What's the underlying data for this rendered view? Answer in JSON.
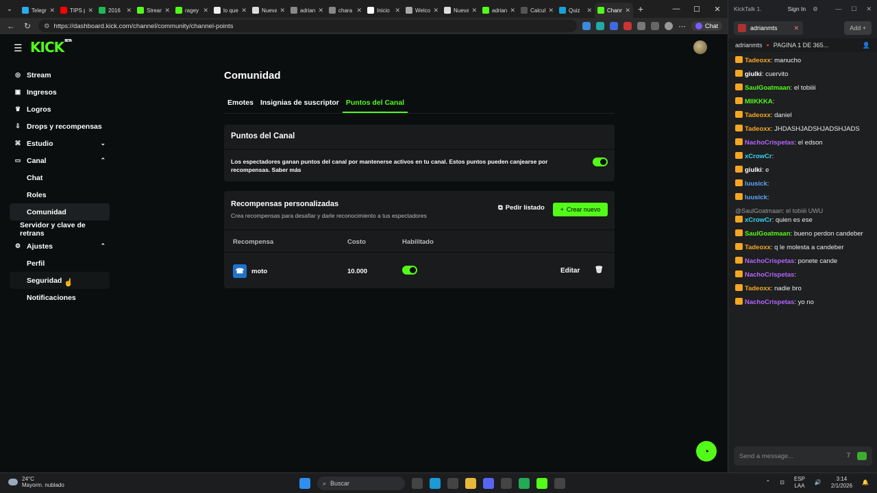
{
  "browser": {
    "tabs": [
      {
        "title": "Telegr",
        "color": "#2aabee"
      },
      {
        "title": "TIPS p",
        "color": "#ff0000"
      },
      {
        "title": "2016",
        "color": "#1db954"
      },
      {
        "title": "Stream",
        "color": "#53fc18"
      },
      {
        "title": "ragey",
        "color": "#53fc18"
      },
      {
        "title": "lo que",
        "color": "#eeeeee"
      },
      {
        "title": "Nueva",
        "color": "#dddddd"
      },
      {
        "title": "adrian",
        "color": "#888888"
      },
      {
        "title": "chara",
        "color": "#888888"
      },
      {
        "title": "Inicio",
        "color": "#ffffff"
      },
      {
        "title": "Welco",
        "color": "#aaaaaa"
      },
      {
        "title": "Nueva",
        "color": "#dddddd"
      },
      {
        "title": "adrian",
        "color": "#53fc18"
      },
      {
        "title": "Calcul",
        "color": "#555555"
      },
      {
        "title": "Quiz",
        "color": "#1aa0d8"
      },
      {
        "title": "Chann",
        "color": "#53fc18"
      }
    ],
    "url": "https://dashboard.kick.com/channel/community/channel-points",
    "chat_label": "Chat"
  },
  "logo": {
    "text": "KICK",
    "tag": "BETA"
  },
  "sidebar": {
    "items": [
      {
        "label": "Stream",
        "icon": "((·))"
      },
      {
        "label": "Ingresos",
        "icon": "▣"
      },
      {
        "label": "Logros",
        "icon": "🏆"
      },
      {
        "label": "Drops y recompensas",
        "icon": "⬇"
      },
      {
        "label": "Estudio",
        "icon": "⌘"
      },
      {
        "label": "Canal",
        "icon": "▭"
      },
      {
        "label": "Chat"
      },
      {
        "label": "Roles"
      },
      {
        "label": "Comunidad"
      },
      {
        "label": "Servidor y clave de retrans"
      },
      {
        "label": "Ajustes",
        "icon": "⚙"
      },
      {
        "label": "Perfil"
      },
      {
        "label": "Seguridad"
      },
      {
        "label": "Notificaciones"
      }
    ]
  },
  "page": {
    "title": "Comunidad",
    "tabs": [
      "Emotes",
      "Insignias de suscriptor",
      "Puntos del Canal"
    ],
    "points_card": {
      "title": "Puntos del Canal",
      "description": "Los espectadores ganan puntos del canal por mantenerse activos en tu canal. Estos puntos pueden canjearse por recompensas. Saber más",
      "enabled": true
    },
    "rewards_card": {
      "title": "Recompensas personalizadas",
      "subtitle": "Crea recompensas para desafiar y darle reconocimiento a tus espectadores",
      "pedir_label": "Pedir listado",
      "crear_label": "Crear nuevo",
      "columns": [
        "Recompensa",
        "Costo",
        "Habilitado"
      ],
      "rows": [
        {
          "name": "moto",
          "cost": "10.000",
          "enabled": true,
          "edit_label": "Editar"
        }
      ]
    }
  },
  "kicktalk": {
    "app_title": "KickTalk 1.",
    "sign_in": "Sign In",
    "channel_tab": "adrianmts",
    "add_label": "Add",
    "header_channel": "adrianmts",
    "header_info": "PAGINA 1 DE 365...",
    "messages": [
      {
        "user": "Tadeoxx",
        "color": "u-or",
        "text": "manucho"
      },
      {
        "user": "giulki",
        "color": "u-wh",
        "text": "cuervito"
      },
      {
        "user": "SaulGoatmaan",
        "color": "u-gr",
        "text": "el tobiiii"
      },
      {
        "user": "MIIKKKA",
        "color": "u-gr",
        "text": ""
      },
      {
        "user": "Tadeoxx",
        "color": "u-or",
        "text": "daniel"
      },
      {
        "user": "Tadeoxx",
        "color": "u-or",
        "text": "JHDASHJADSHJADSHJADS"
      },
      {
        "user": "NachoCrispetas",
        "color": "u-pu",
        "text": "el edson"
      },
      {
        "user": "xCrowCr",
        "color": "u-cy",
        "text": ""
      },
      {
        "user": "giulki",
        "color": "u-wh",
        "text": "e"
      },
      {
        "user": "luusick",
        "color": "u-bl",
        "text": ""
      },
      {
        "user": "luusick",
        "color": "u-bl",
        "text": ""
      },
      {
        "user": "xCrowCr",
        "color": "u-cy",
        "text": "quien es ese",
        "reply": "@SaulGoatmaan: el tobiiii UWU"
      },
      {
        "user": "SaulGoatmaan",
        "color": "u-gr",
        "text": "bueno perdon candeber"
      },
      {
        "user": "Tadeoxx",
        "color": "u-or",
        "text": "q le molesta a candeber"
      },
      {
        "user": "NachoCrispetas",
        "color": "u-pu",
        "text": "ponete cande"
      },
      {
        "user": "NachoCrispetas",
        "color": "u-pu",
        "text": ""
      },
      {
        "user": "Tadeoxx",
        "color": "u-or",
        "text": "nadie bro"
      },
      {
        "user": "NachoCrispetas",
        "color": "u-pu",
        "text": "yo no"
      }
    ],
    "input_placeholder": "Send a message..."
  },
  "taskbar": {
    "temp": "24°C",
    "weather": "Mayorm. nublado",
    "search": "Buscar",
    "lang": "ESP",
    "lang2": "LAA",
    "time": "3:14",
    "date": "2/1/2026"
  }
}
